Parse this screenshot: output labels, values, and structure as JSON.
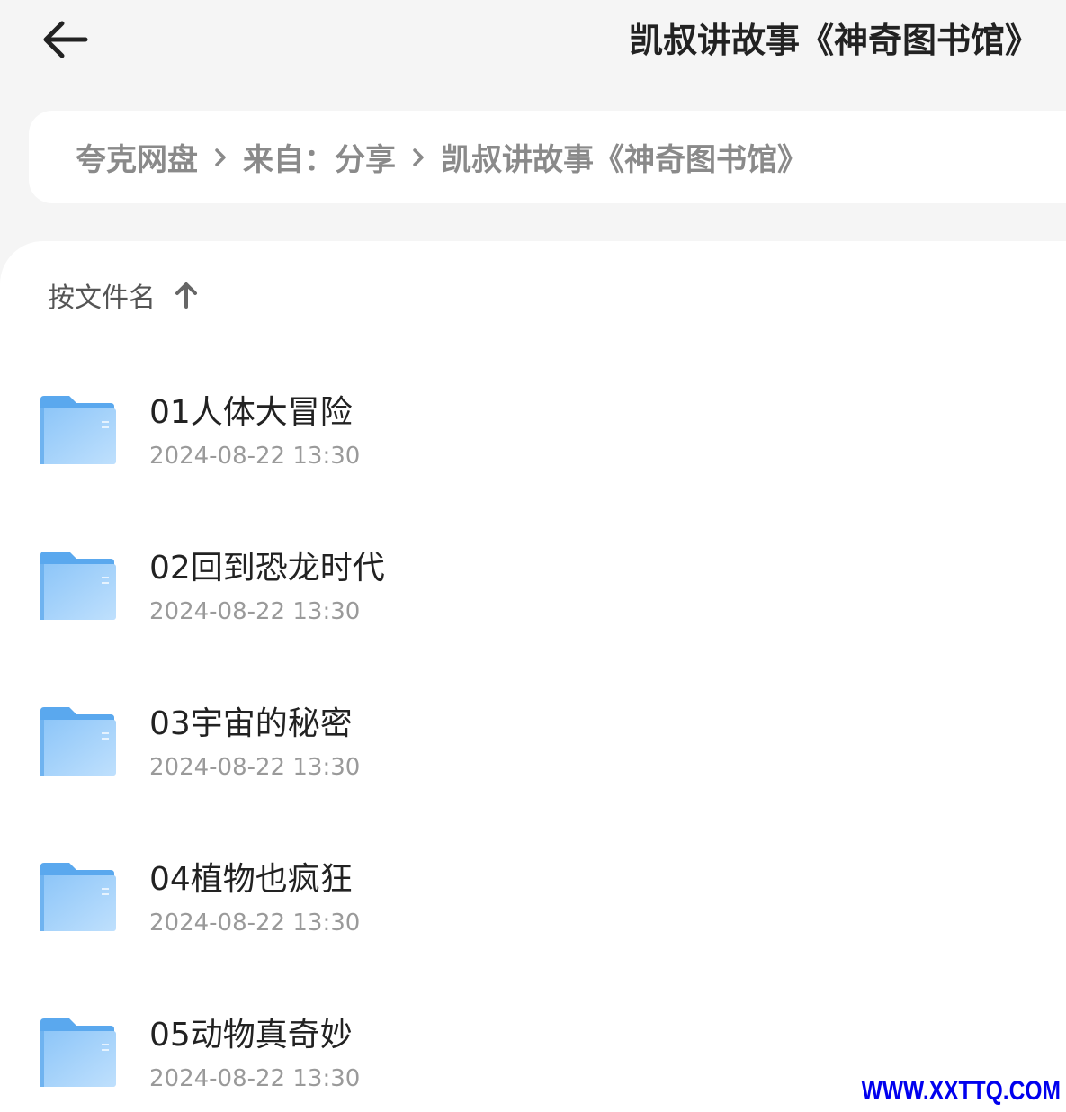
{
  "header": {
    "back_icon": "arrow-left-icon",
    "title": "凯叔讲故事《神奇图书馆》"
  },
  "breadcrumb": {
    "items": [
      "夸克网盘",
      "来自：分享",
      "凯叔讲故事《神奇图书馆》"
    ],
    "separator_icon": "chevron-right-icon"
  },
  "sort": {
    "label": "按文件名",
    "direction_icon": "arrow-up-icon"
  },
  "files": [
    {
      "name": "01人体大冒险",
      "date": "2024-08-22 13:30",
      "icon": "folder-icon"
    },
    {
      "name": "02回到恐龙时代",
      "date": "2024-08-22 13:30",
      "icon": "folder-icon"
    },
    {
      "name": "03宇宙的秘密",
      "date": "2024-08-22 13:30",
      "icon": "folder-icon"
    },
    {
      "name": "04植物也疯狂",
      "date": "2024-08-22 13:30",
      "icon": "folder-icon"
    },
    {
      "name": "05动物真奇妙",
      "date": "2024-08-22 13:30",
      "icon": "folder-icon"
    }
  ],
  "watermark": "WWW.XXTTQ.COM",
  "colors": {
    "folder_top": "#5aa8ee",
    "folder_body": "#a9d4fb",
    "text_primary": "#222222",
    "text_secondary": "#9a9a9a"
  }
}
